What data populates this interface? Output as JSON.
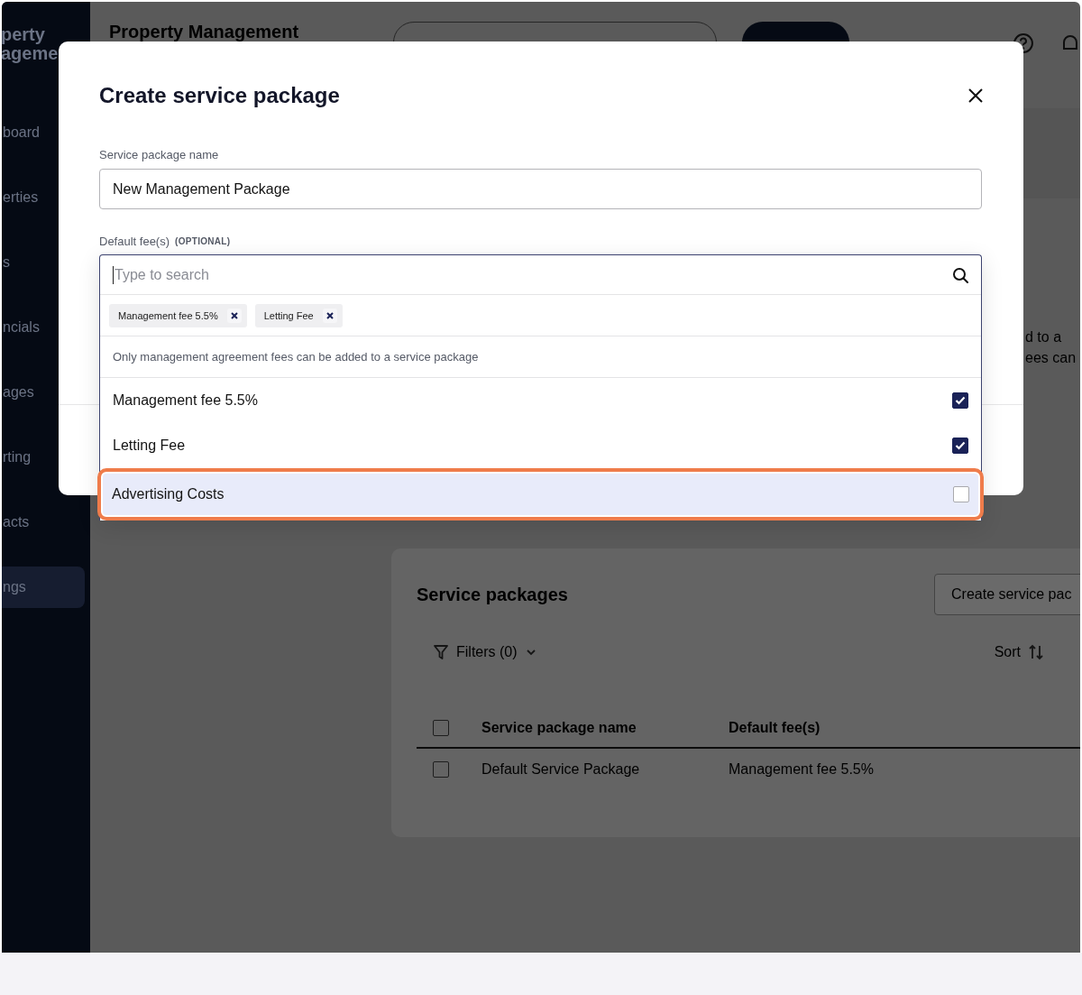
{
  "sidebar": {
    "brand_lines": [
      "perty",
      "ageme"
    ],
    "items": [
      {
        "label": "board",
        "selected": false
      },
      {
        "label": "erties",
        "selected": false
      },
      {
        "label": "s",
        "selected": false
      },
      {
        "label": "ncials",
        "selected": false
      },
      {
        "label": "ages",
        "selected": false
      },
      {
        "label": "rting",
        "selected": false
      },
      {
        "label": "acts",
        "selected": false
      },
      {
        "label": "ngs",
        "selected": true
      }
    ]
  },
  "header": {
    "title": "Property Management"
  },
  "background_note": {
    "lines": [
      "d to a",
      "ees can"
    ]
  },
  "service_packages": {
    "title": "Service packages",
    "create_button": "Create service pac",
    "filters": "Filters (0)",
    "sort": "Sort",
    "table": {
      "all_selected": false,
      "columns": [
        "Service package name",
        "Default fee(s)"
      ],
      "rows": [
        {
          "cells": [
            "Default Service Package",
            "Management fee 5.5%"
          ],
          "selected": false
        }
      ]
    }
  },
  "modal": {
    "title": "Create service package",
    "name_field": {
      "label": "Service package name",
      "value": "New Management Package"
    },
    "fees_field": {
      "label": "Default fee(s)",
      "optional_tag": "(OPTIONAL)",
      "placeholder": "Type to search",
      "chips": [
        "Management fee 5.5%",
        "Letting Fee"
      ],
      "note": "Only management agreement fees can be added to a service package",
      "options": [
        {
          "label": "Management fee 5.5%",
          "checked": true,
          "highlighted": false
        },
        {
          "label": "Letting Fee",
          "checked": true,
          "highlighted": false
        },
        {
          "label": "Advertising Costs",
          "checked": false,
          "highlighted": true
        }
      ]
    }
  }
}
